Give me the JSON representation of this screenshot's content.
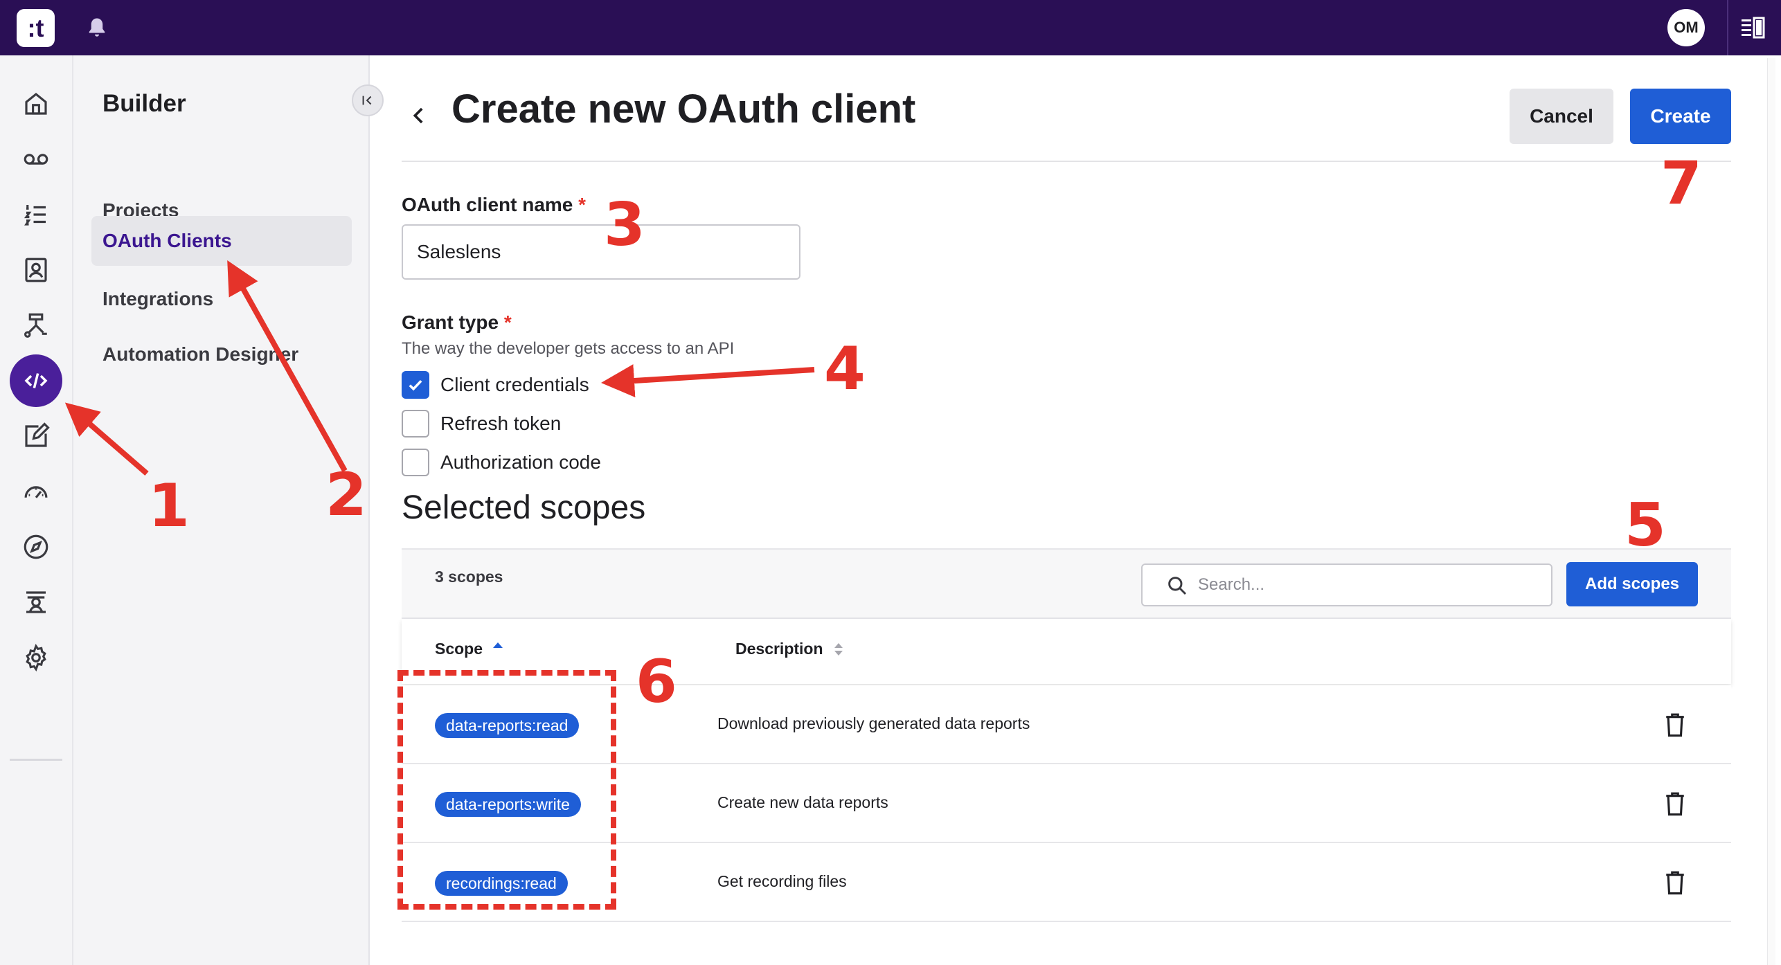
{
  "topbar": {
    "logo_text": ":t",
    "avatar_initials": "OM"
  },
  "icons": {
    "rail": [
      "home-icon",
      "voicemail-icon",
      "list-icon",
      "contacts-icon",
      "flow-icon",
      "code-icon",
      "edit-icon",
      "dashboard-icon",
      "compass-icon",
      "agent-icon",
      "settings-icon"
    ]
  },
  "sidebar": {
    "title": "Builder",
    "items": [
      {
        "label": "Projects"
      },
      {
        "label": "OAuth Clients"
      },
      {
        "label": "Integrations"
      },
      {
        "label": "Automation Designer"
      }
    ]
  },
  "header": {
    "title": "Create new OAuth client",
    "cancel_label": "Cancel",
    "create_label": "Create"
  },
  "form": {
    "name_label": "OAuth client name",
    "required_mark": "*",
    "name_value": "Saleslens",
    "grant_label": "Grant type",
    "grant_help": "The way the developer gets access to an API",
    "grant_options": [
      {
        "label": "Client credentials",
        "checked": true
      },
      {
        "label": "Refresh token",
        "checked": false
      },
      {
        "label": "Authorization code",
        "checked": false
      }
    ]
  },
  "scopes": {
    "title": "Selected scopes",
    "count_text": "3 scopes",
    "search_placeholder": "Search...",
    "add_label": "Add scopes",
    "columns": {
      "scope": "Scope",
      "description": "Description"
    },
    "rows": [
      {
        "scope": "data-reports:read",
        "description": "Download previously generated data reports"
      },
      {
        "scope": "data-reports:write",
        "description": "Create new data reports"
      },
      {
        "scope": "recordings:read",
        "description": "Get recording files"
      }
    ]
  },
  "annotations": [
    "1",
    "2",
    "3",
    "4",
    "5",
    "6",
    "7"
  ],
  "colors": {
    "topbar": "#2a0f55",
    "accent": "#1f5ed6",
    "active_nav": "#4a1f9a",
    "annotation": "#e5332a"
  }
}
